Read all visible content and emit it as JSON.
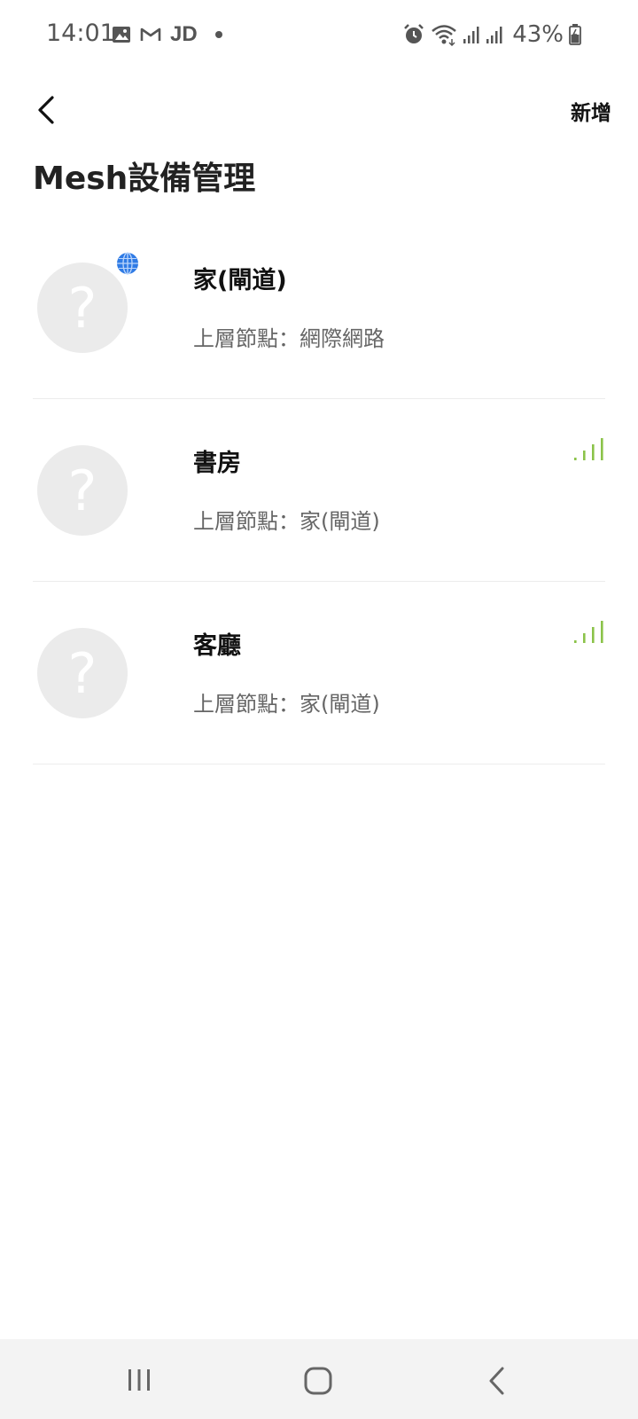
{
  "status_bar": {
    "time": "14:01",
    "left_icons": [
      "gallery-icon",
      "gmail-icon",
      "jd-icon",
      "dot-icon"
    ],
    "jd_label": "JD",
    "right_icons": [
      "alarm-icon",
      "wifi-icon",
      "signal-icon",
      "signal-icon",
      "battery-icon"
    ],
    "battery": "43%"
  },
  "header": {
    "back_icon": "back-arrow-icon",
    "add_label": "新增",
    "title": "Mesh設備管理"
  },
  "devices": [
    {
      "name": "家(閘道)",
      "parent": "上層節點：網際網路",
      "badge": "globe-icon",
      "signal": null
    },
    {
      "name": "書房",
      "parent": "上層節點：家(閘道)",
      "badge": null,
      "signal": "signal-strength-icon"
    },
    {
      "name": "客廳",
      "parent": "上層節點：家(閘道)",
      "badge": null,
      "signal": "signal-strength-icon"
    }
  ],
  "avatar_placeholder": "?",
  "colors": {
    "signal_green": "#8bc34a",
    "globe_blue": "#2f7be5",
    "avatar_bg": "#ebebeb",
    "nav_bg": "#f3f3f3"
  },
  "nav_bar": [
    "recents-icon",
    "home-icon",
    "back-icon"
  ]
}
